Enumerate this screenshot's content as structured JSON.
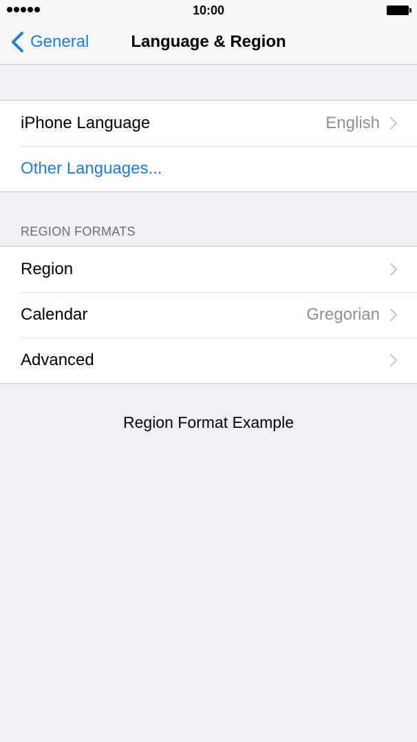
{
  "status_bar": {
    "time": "10:00",
    "signal_icon": "signal-dots-icon",
    "battery_icon": "battery-icon"
  },
  "nav": {
    "back_label": "General",
    "back_icon": "chevron-left-icon",
    "title": "Language & Region"
  },
  "language_group": {
    "rows": [
      {
        "title": "iPhone Language",
        "value": "English"
      },
      {
        "title": "Other Languages..."
      }
    ]
  },
  "region_group": {
    "header": "REGION FORMATS",
    "rows": [
      {
        "title": "Region",
        "value": ""
      },
      {
        "title": "Calendar",
        "value": "Gregorian"
      },
      {
        "title": "Advanced",
        "value": ""
      }
    ]
  },
  "footer": {
    "example_label": "Region Format Example"
  },
  "colors": {
    "accent": "#1a7ee6",
    "background": "#efeff4",
    "secondary_text": "#8e8e93"
  }
}
